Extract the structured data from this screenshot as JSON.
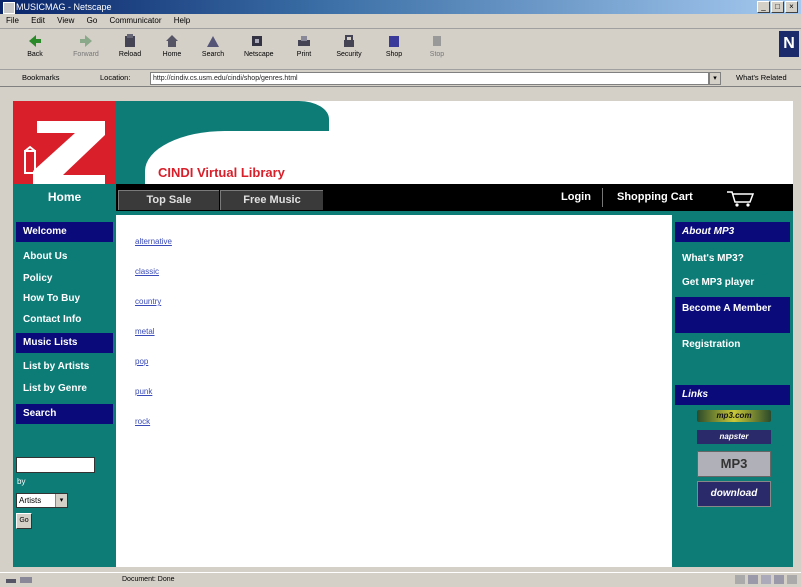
{
  "window": {
    "title": "MUSICMAG - Netscape"
  },
  "menu": [
    "File",
    "Edit",
    "View",
    "Go",
    "Communicator",
    "Help"
  ],
  "toolbar": [
    {
      "label": "Back",
      "icon": "back-arrow-icon"
    },
    {
      "label": "Forward",
      "icon": "forward-arrow-icon"
    },
    {
      "label": "Reload",
      "icon": "reload-icon"
    },
    {
      "label": "Home",
      "icon": "home-icon"
    },
    {
      "label": "Search",
      "icon": "search-icon"
    },
    {
      "label": "Netscape",
      "icon": "netscape-icon"
    },
    {
      "label": "Print",
      "icon": "print-icon"
    },
    {
      "label": "Security",
      "icon": "security-icon"
    },
    {
      "label": "Shop",
      "icon": "shop-icon"
    },
    {
      "label": "Stop",
      "icon": "stop-icon"
    }
  ],
  "location": {
    "bookmarks_label": "Bookmarks",
    "location_label": "Location:",
    "url": "http://cindiv.cs.usm.edu/cindi/shop/genres.html",
    "related_label": "What's Related"
  },
  "site": {
    "logo_letter": "Z",
    "title": "CINDI Virtual Library",
    "nav": {
      "home": "Home",
      "top_sale": "Top Sale",
      "free_music": "Free Music",
      "login": "Login",
      "cart": "Shopping Cart"
    },
    "left": {
      "welcome": "Welcome",
      "about_us": "About Us",
      "policy": "Policy",
      "how_to_buy": "How To Buy",
      "contact_info": "Contact Info",
      "music_lists": "Music Lists",
      "list_by_artists": "List by Artists",
      "list_by_genre": "List by Genre",
      "search": "Search",
      "search_by_label": "by",
      "search_select": "Artists",
      "search_go": "Go"
    },
    "genres": [
      "alternative",
      "classic",
      "country",
      "metal",
      "pop",
      "punk",
      "rock"
    ],
    "right": {
      "about_mp3": "About MP3",
      "whats_mp3": "What's MP3?",
      "get_player": "Get MP3 player",
      "become_member": "Become A Member",
      "registration": "Registration",
      "links": "Links",
      "banners": [
        "mp3.com",
        "napster",
        "MP3",
        "download"
      ]
    }
  },
  "status": {
    "text": "Document: Done"
  }
}
